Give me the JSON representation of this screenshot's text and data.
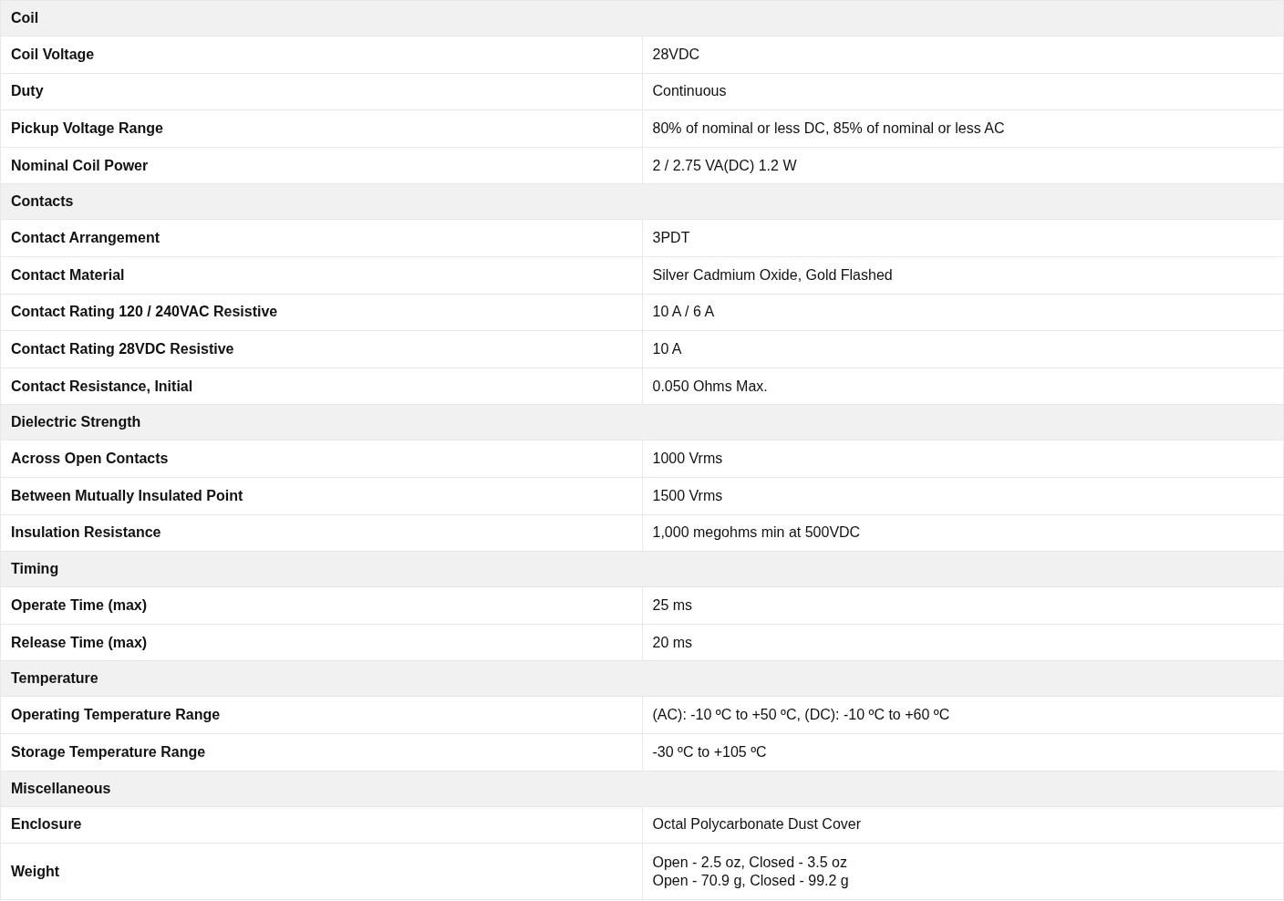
{
  "sections": [
    {
      "title": "Coil",
      "rows": [
        {
          "label": "Coil Voltage",
          "value": [
            "28VDC"
          ]
        },
        {
          "label": "Duty",
          "value": [
            "Continuous"
          ]
        },
        {
          "label": "Pickup Voltage Range",
          "value": [
            "80% of nominal or less DC, 85% of nominal or less AC"
          ]
        },
        {
          "label": "Nominal Coil Power",
          "value": [
            "2 / 2.75 VA(DC) 1.2 W"
          ]
        }
      ]
    },
    {
      "title": "Contacts",
      "rows": [
        {
          "label": "Contact Arrangement",
          "value": [
            "3PDT"
          ]
        },
        {
          "label": "Contact Material",
          "value": [
            "Silver Cadmium Oxide, Gold Flashed"
          ]
        },
        {
          "label": "Contact Rating 120 / 240VAC Resistive",
          "value": [
            "10 A / 6 A"
          ]
        },
        {
          "label": "Contact Rating 28VDC Resistive",
          "value": [
            "10 A"
          ]
        },
        {
          "label": "Contact Resistance, Initial",
          "value": [
            "0.050 Ohms Max."
          ]
        }
      ]
    },
    {
      "title": "Dielectric Strength",
      "rows": [
        {
          "label": "Across Open Contacts",
          "value": [
            "1000 Vrms"
          ]
        },
        {
          "label": "Between Mutually Insulated Point",
          "value": [
            "1500 Vrms"
          ]
        },
        {
          "label": "Insulation Resistance",
          "value": [
            "1,000 megohms min at 500VDC"
          ]
        }
      ]
    },
    {
      "title": "Timing",
      "rows": [
        {
          "label": "Operate Time (max)",
          "value": [
            "25 ms"
          ]
        },
        {
          "label": "Release Time (max)",
          "value": [
            "20 ms"
          ]
        }
      ]
    },
    {
      "title": "Temperature",
      "rows": [
        {
          "label": "Operating Temperature Range",
          "value": [
            "(AC): -10 ºC to +50 ºC, (DC): -10 ºC to +60 ºC"
          ]
        },
        {
          "label": "Storage Temperature Range",
          "value": [
            "-30 ºC to +105 ºC"
          ]
        }
      ]
    },
    {
      "title": "Miscellaneous",
      "rows": [
        {
          "label": "Enclosure",
          "value": [
            "Octal Polycarbonate Dust Cover"
          ]
        },
        {
          "label": "Weight",
          "value": [
            "Open - 2.5 oz, Closed - 3.5 oz",
            "Open - 70.9 g, Closed - 99.2 g"
          ]
        }
      ]
    }
  ]
}
